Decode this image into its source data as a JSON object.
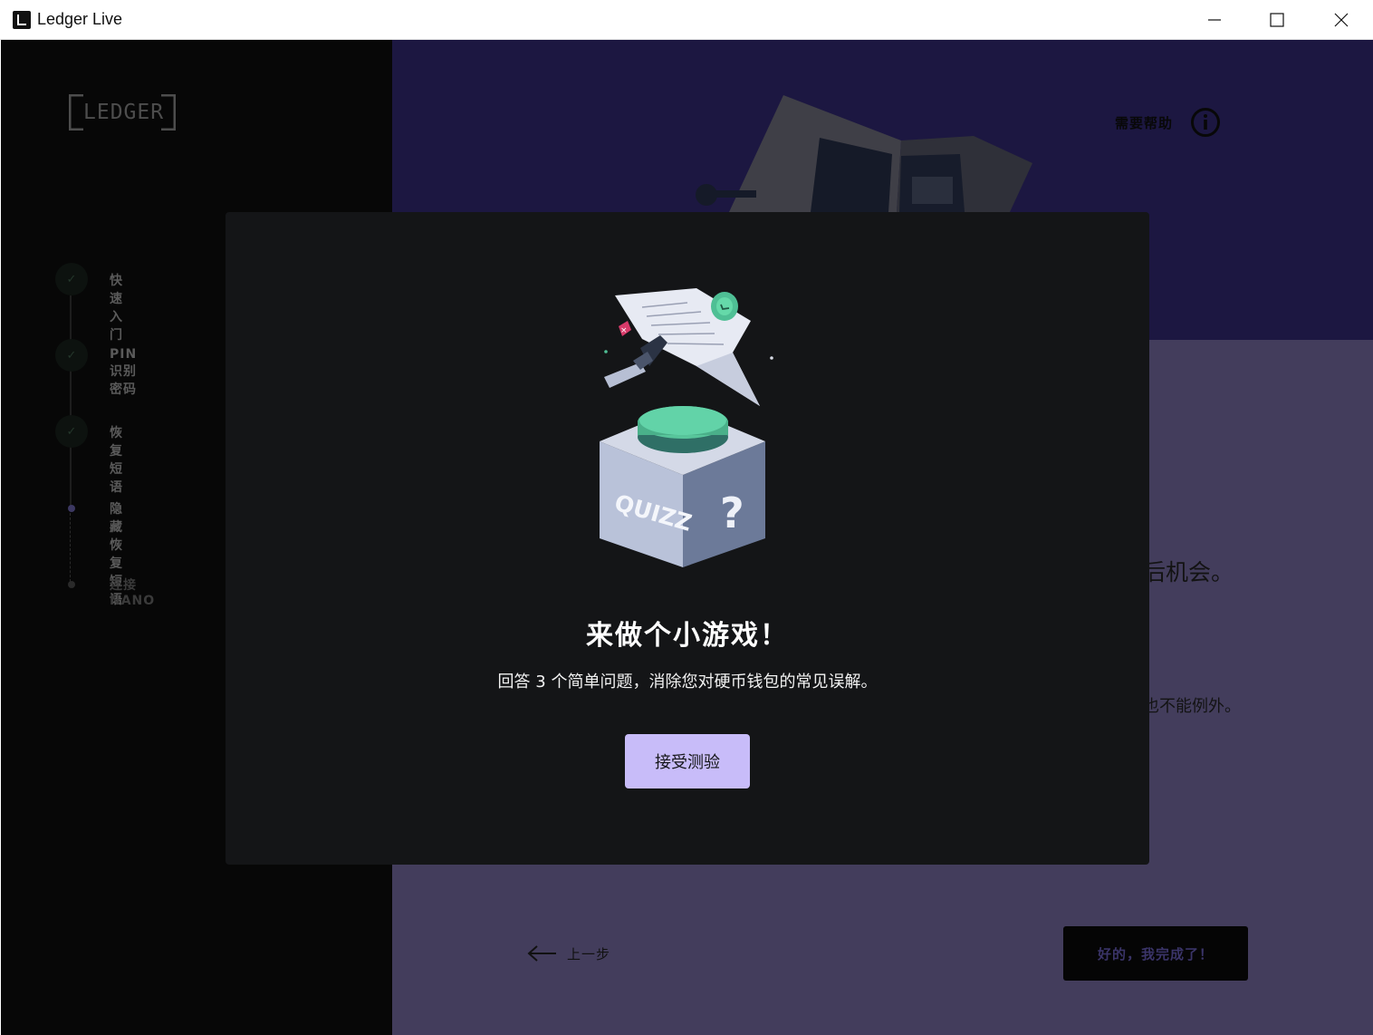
{
  "window": {
    "title": "Ledger Live",
    "controls": [
      "minimize-icon",
      "maximize-icon",
      "close-icon"
    ]
  },
  "sidebar": {
    "logo_text": "LEDGER",
    "steps": [
      {
        "label": "快速入门",
        "state": "done"
      },
      {
        "label": "PIN 识别密码",
        "state": "done"
      },
      {
        "label": "恢复短语",
        "state": "done"
      },
      {
        "label": "隐藏恢复短语",
        "state": "current"
      },
      {
        "label": "连接 NANO",
        "state": "upcoming"
      }
    ]
  },
  "header": {
    "help_label": "需要帮助"
  },
  "background": {
    "partial_line_1": "后机会。",
    "partial_line_2": "也不能例外。",
    "back_label": "上一步",
    "done_label": "好的，我完成了！"
  },
  "modal": {
    "illustration_text": "QUIZZ",
    "illustration_mark": "?",
    "title": "来做个小游戏！",
    "description": "回答 3 个简单问题，消除您对硬币钱包的常见误解。",
    "button_label": "接受测验"
  },
  "colors": {
    "sidebar_bg": "#070707",
    "main_top_bg": "#1c1741",
    "main_bottom_bg": "#433d5c",
    "modal_bg": "#141517",
    "accent": "#c8bcf9"
  }
}
